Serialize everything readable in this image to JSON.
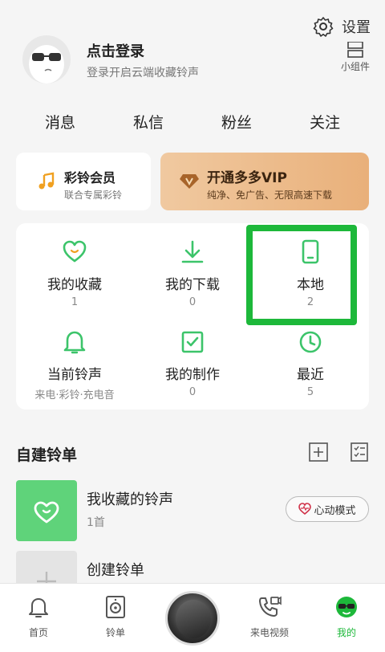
{
  "profile": {
    "login_title": "点击登录",
    "login_sub": "登录开启云端收藏铃声"
  },
  "settings": {
    "label": "设置",
    "icon": "gear-icon"
  },
  "widget": {
    "label": "小组件",
    "icon": "widget-icon"
  },
  "stats": [
    "消息",
    "私信",
    "粉丝",
    "关注"
  ],
  "member_card": {
    "title": "彩铃会员",
    "subtitle": "联合专属彩铃",
    "icon": "music-note-icon"
  },
  "vip_card": {
    "title": "开通多多VIP",
    "subtitle": "纯净、免广告、无限高速下载",
    "icon": "diamond-icon"
  },
  "grid": [
    {
      "label": "我的收藏",
      "count": "1",
      "icon": "heart-icon"
    },
    {
      "label": "我的下载",
      "count": "0",
      "icon": "download-icon"
    },
    {
      "label": "本地",
      "count": "2",
      "icon": "phone-icon"
    },
    {
      "label": "当前铃声",
      "count": "来电·彩铃·充电音",
      "icon": "bell-icon"
    },
    {
      "label": "我的制作",
      "count": "0",
      "icon": "checkbox-icon"
    },
    {
      "label": "最近",
      "count": "5",
      "icon": "clock-icon"
    }
  ],
  "self_list": {
    "title": "自建铃单",
    "items": [
      {
        "name": "我收藏的铃声",
        "sub": "1首"
      },
      {
        "name": "创建铃单",
        "sub": ""
      }
    ],
    "mode_button": "心动模式"
  },
  "tabbar": [
    {
      "label": "首页",
      "icon": "bell-icon"
    },
    {
      "label": "铃单",
      "icon": "speaker-icon"
    },
    {
      "label": "来电视频",
      "icon": "phone-video-icon"
    },
    {
      "label": "我的",
      "icon": "user-face-icon",
      "active": true
    }
  ],
  "colors": {
    "accent": "#1db83a",
    "icon_green": "#3cc46a",
    "vip_gold": "#e9b07a"
  }
}
